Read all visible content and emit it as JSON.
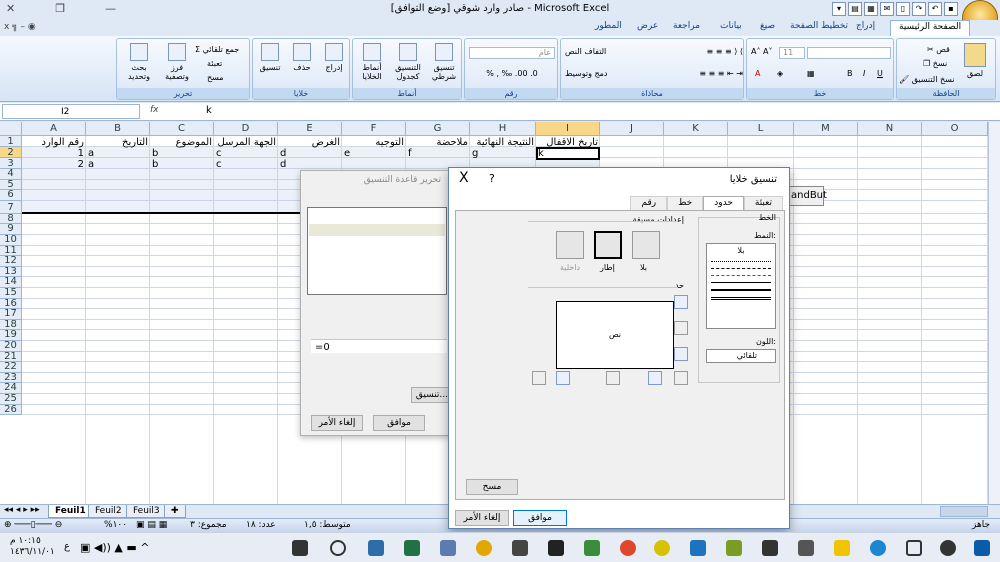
{
  "window": {
    "title": "صادر وارد شوقي  [وضع التوافق] - Microsoft Excel",
    "controls": [
      "x",
      "ב",
      "—"
    ]
  },
  "ribbon": {
    "tabs": [
      "الصفحة الرئيسية",
      "إدراج",
      "تخطيط الصفحة",
      "صيغ",
      "بيانات",
      "مراجعة",
      "عرض",
      "المطور"
    ],
    "active_tab": "الصفحة الرئيسية",
    "mdi_controls": "x  ╗  –  ◉",
    "groups": {
      "clipboard": {
        "label": "الحافظة",
        "paste": "لصق",
        "cut": "قص",
        "copy": "نسخ",
        "format_painter": "نسخ التنسيق"
      },
      "font": {
        "label": "خط",
        "font_name": "",
        "font_size": "11"
      },
      "alignment": {
        "label": "محاذاة",
        "wrap": "التفاف النص",
        "merge": "دمج وتوسيط"
      },
      "number": {
        "label": "رقم",
        "format": "عام"
      },
      "styles": {
        "label": "أنماط",
        "conditional": "تنسيق شرطي",
        "format_table": "التنسيق كجدول",
        "cell_styles": "أنماط الخلايا"
      },
      "cells": {
        "label": "خلايا",
        "insert": "إدراج",
        "delete": "حذف",
        "format": "تنسيق"
      },
      "editing": {
        "label": "تحرير",
        "autosum": "جمع تلقائي",
        "fill": "تعبئة",
        "clear": "مسح",
        "sort": "فرز وتصفية",
        "find": "بحث وتحديد"
      }
    }
  },
  "formula_bar": {
    "name_box": "I2",
    "fx": "fx",
    "content": "k"
  },
  "grid": {
    "columns": [
      "A",
      "B",
      "C",
      "D",
      "E",
      "F",
      "G",
      "H",
      "I",
      "J",
      "K",
      "L",
      "M",
      "N",
      "O"
    ],
    "selected_column": "I",
    "rows": [
      "1",
      "2",
      "3",
      "4",
      "5",
      "6",
      "7",
      "8",
      "9",
      "10",
      "11",
      "12",
      "13",
      "14",
      "15",
      "16",
      "17",
      "18",
      "19",
      "20",
      "21",
      "22",
      "23",
      "24",
      "25",
      "26"
    ],
    "selected_rows": [
      "2"
    ],
    "header_row": [
      "رقم الوارد",
      "التاريخ",
      "الموضوع",
      "الجهة المرسل اليها",
      "الغرض",
      "التوجيه",
      "ملاحضة",
      "النتيجة النهائية",
      "تاريخ الاقفال"
    ],
    "data_rows": [
      [
        "1",
        "a",
        "b",
        "c",
        "d",
        "e",
        "f",
        "g",
        "k"
      ],
      [
        "2",
        "a",
        "b",
        "c",
        "d",
        "",
        "",
        "",
        ""
      ]
    ],
    "floating_button": "andBut"
  },
  "dialog_edit_rule": {
    "title": "تحرير قاعدة التنسيق",
    "formula": "=0",
    "format_button": "تنسيق...",
    "ok": "موافق",
    "cancel": "إلغاء الأمر"
  },
  "dialog_format_cells": {
    "title": "تنسيق خلايا",
    "help": "?",
    "close": "X",
    "tabs": [
      "تعبئة",
      "حدود",
      "خط",
      "رقم"
    ],
    "active_tab": "حدود",
    "line_group": "الخط",
    "style_label": "النمط:",
    "style_none": "بلا",
    "color_label": "اللون:",
    "color_value": "تلقائي",
    "presets_label": "إعدادات مسبقة",
    "presets": [
      "بلا",
      "إطار",
      "داخلية"
    ],
    "border_label": "حد",
    "preview_text": "نص",
    "clear_button": "مسح",
    "ok": "موافق",
    "cancel": "إلغاء الأمر"
  },
  "sheets": {
    "tabs": [
      "Feuil1",
      "Feuil2",
      "Feuil3"
    ],
    "active": "Feuil1"
  },
  "status": {
    "ready": "جاهز",
    "average": "متوسط: ١,٥",
    "count": "عدد: ١٨",
    "sum": "مجموع: ٣",
    "zoom": "%١٠٠"
  },
  "taskbar": {
    "time": "١٠:١٥ م",
    "date": "١٤٣٦/١١/٠١",
    "lang": "ع"
  },
  "colors": {
    "selected_header": "#f8d888",
    "ribbon_blue": "#15428b"
  }
}
